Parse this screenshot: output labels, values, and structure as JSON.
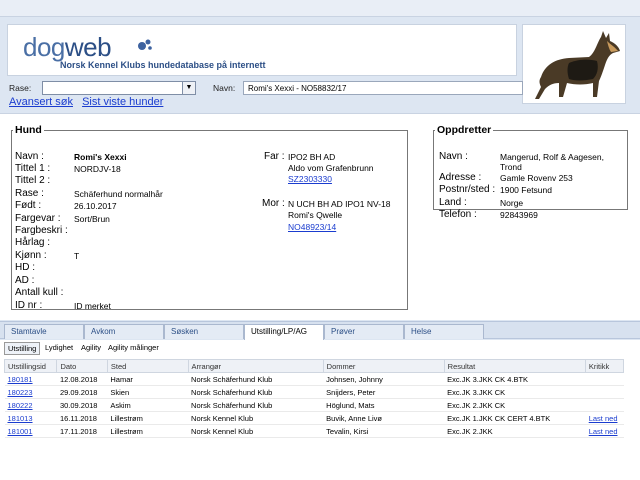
{
  "header": {
    "logo_dog": "dog",
    "logo_web": "web",
    "tagline": "Norsk Kennel Klubs hundedatabase på internett"
  },
  "search": {
    "rase_label": "Rase:",
    "rase_value": "",
    "navn_label": "Navn:",
    "navn_value": "Romi's Xexxi - NO58832/17"
  },
  "links": {
    "advanced": "Avansert søk",
    "recent": "Sist viste hunder"
  },
  "hund": {
    "legend": "Hund",
    "fields": [
      {
        "key": "Navn :",
        "value": "Romi's Xexxi"
      },
      {
        "key": "Tittel 1 :",
        "value": "NORDJV-18"
      },
      {
        "key": "Tittel 2 :",
        "value": ""
      },
      {
        "key": "Rase :",
        "value": "Schäferhund normalhår"
      },
      {
        "key": "Født :",
        "value": "26.10.2017"
      },
      {
        "key": "Fargevar :",
        "value": "Sort/Brun"
      },
      {
        "key": "Fargbeskri :",
        "value": ""
      },
      {
        "key": "Hårlag :",
        "value": ""
      },
      {
        "key": "Kjønn :",
        "value": "T"
      },
      {
        "key": "HD :",
        "value": ""
      },
      {
        "key": "AD :",
        "value": ""
      },
      {
        "key": "Antall kull :",
        "value": ""
      },
      {
        "key": "ID nr :",
        "value": "ID merket"
      }
    ],
    "far_label": "Far :",
    "far_title": "IPO2 BH AD",
    "far_name": "Aldo vom Grafenbrunn",
    "far_reg": "SZ2303330",
    "mor_label": "Mor :",
    "mor_title": "N UCH BH AD IPO1 NV-18",
    "mor_name": "Romi's Qwelle",
    "mor_reg": "NO48923/14"
  },
  "oppdretter": {
    "legend": "Oppdretter",
    "navn_key": "Navn :",
    "navn_value_1": "Mangerud, Rolf & Aagesen,",
    "navn_value_2": "Trond",
    "adresse_key": "Adresse :",
    "adresse_value": "Gamle Rovenv 253",
    "postnr_key": "Postnr/sted :",
    "postnr_value": "1900 Fetsund",
    "land_key": "Land :",
    "land_value": "Norge",
    "telefon_key": "Telefon :",
    "telefon_value": "92843969"
  },
  "tabs": [
    "Stamtavle",
    "Avkom",
    "Søsken",
    "Utstilling/LP/AG",
    "Prøver",
    "Helse"
  ],
  "subtabs": [
    "Utstilling",
    "Lydighet",
    "Agility",
    "Agility målinger"
  ],
  "table": {
    "headers": [
      "Utstillingsid",
      "Dato",
      "Sted",
      "Arrangør",
      "Dommer",
      "Resultat",
      "Kritikk"
    ],
    "rows": [
      {
        "id": "180181",
        "dato": "12.08.2018",
        "sted": "Hamar",
        "arr": "Norsk Schäferhund Klub",
        "dommer": "Johnsen, Johnny",
        "res": "Exc.JK 3.JKK CK 4.BTK",
        "krit": ""
      },
      {
        "id": "180223",
        "dato": "29.09.2018",
        "sted": "Skien",
        "arr": "Norsk Schäferhund Klub",
        "dommer": "Snijders, Peter",
        "res": "Exc.JK 3.JKK CK",
        "krit": ""
      },
      {
        "id": "180222",
        "dato": "30.09.2018",
        "sted": "Askim",
        "arr": "Norsk Schäferhund Klub",
        "dommer": "Höglund, Mats",
        "res": "Exc.JK 2.JKK CK",
        "krit": ""
      },
      {
        "id": "181013",
        "dato": "16.11.2018",
        "sted": "Lillestrøm",
        "arr": "Norsk Kennel Klub",
        "dommer": "Buvik, Anne Livø",
        "res": "Exc.JK 1.JKK CK CERT 4.BTK",
        "krit": "Last ned"
      },
      {
        "id": "181001",
        "dato": "17.11.2018",
        "sted": "Lillestrøm",
        "arr": "Norsk Kennel Klub",
        "dommer": "Tevalin, Kirsi",
        "res": "Exc.JK 2.JKK",
        "krit": "Last ned"
      }
    ]
  }
}
